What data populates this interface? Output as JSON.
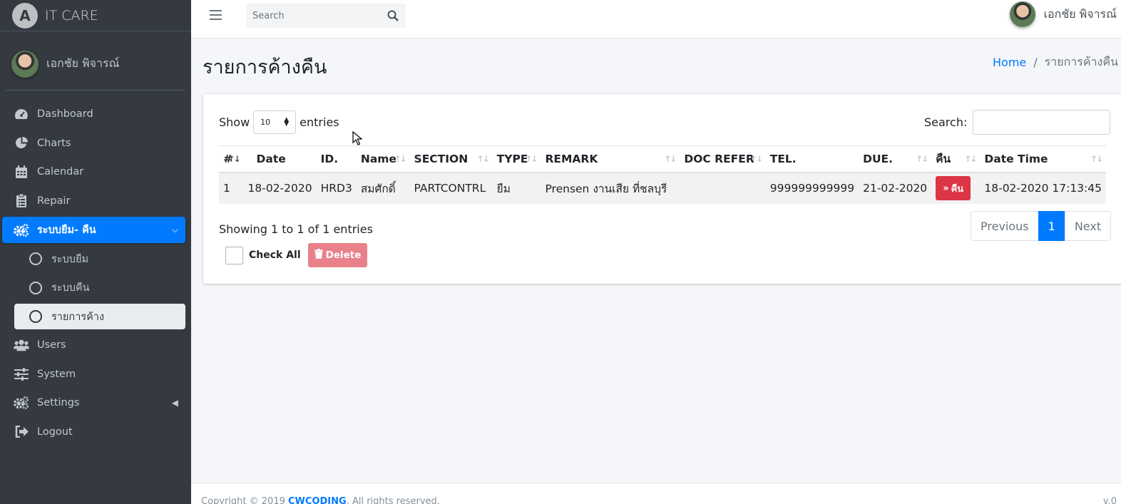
{
  "brand": {
    "logo_letter": "A",
    "name": "IT CARE"
  },
  "user": {
    "name": "เอกชัย พิจารณ์"
  },
  "sidebar": {
    "items": [
      {
        "label": "Dashboard",
        "icon": "tachometer-icon"
      },
      {
        "label": "Charts",
        "icon": "pie-chart-icon"
      },
      {
        "label": "Calendar",
        "icon": "calendar-icon"
      },
      {
        "label": "Repair",
        "icon": "clipboard-icon"
      },
      {
        "label": "ระบบยืม- คืน",
        "icon": "cogs-icon",
        "active": true
      },
      {
        "label": "Users",
        "icon": "users-icon"
      },
      {
        "label": "System",
        "icon": "sliders-icon"
      },
      {
        "label": "Settings",
        "icon": "cogs-icon"
      },
      {
        "label": "Logout",
        "icon": "sign-out-icon"
      }
    ],
    "sub_items": [
      {
        "label": "ระบบยืม"
      },
      {
        "label": "ระบบคืน"
      },
      {
        "label": "รายการค้าง",
        "current": true
      }
    ]
  },
  "navbar": {
    "search_placeholder": "Search"
  },
  "page": {
    "title": "รายการค้างคืน",
    "breadcrumb_home": "Home",
    "breadcrumb_sep": "/",
    "breadcrumb_current": "รายการค้างคืน"
  },
  "table_controls": {
    "show_label": "Show",
    "length_value": "10",
    "entries_label": "entries",
    "search_label": "Search:"
  },
  "table": {
    "columns": [
      "#",
      "Date",
      "ID.",
      "Name",
      "SECTION",
      "TYPE",
      "REMARK",
      "DOC REFER",
      "TEL.",
      "DUE.",
      "คืน",
      "Date Time"
    ],
    "rows": [
      {
        "no": "1",
        "date": "18-02-2020",
        "id": "HRD3",
        "name": "สมศักดิ์",
        "section": "PARTCONTRL",
        "type": "ยืม",
        "remark": "Prensen งานเสีย ที่ชลบุรี",
        "doc_refer": "",
        "tel": "999999999999",
        "due": "21-02-2020",
        "return_label": "คืน",
        "datetime": "18-02-2020 17:13:45"
      }
    ]
  },
  "info": "Showing 1 to 1 of 1 entries",
  "pagination": {
    "previous": "Previous",
    "page": "1",
    "next": "Next"
  },
  "bulk": {
    "check_all": "Check All",
    "delete": "Delete"
  },
  "footer": {
    "copyright_prefix": "Copyright © 2019",
    "company": "CWCODING",
    "rights": "All rights reserved.",
    "version": "v.0"
  },
  "colors": {
    "sidebar": "#343a40",
    "primary": "#007bff",
    "danger": "#dc3545",
    "delete_disabled": "#e8818a"
  }
}
